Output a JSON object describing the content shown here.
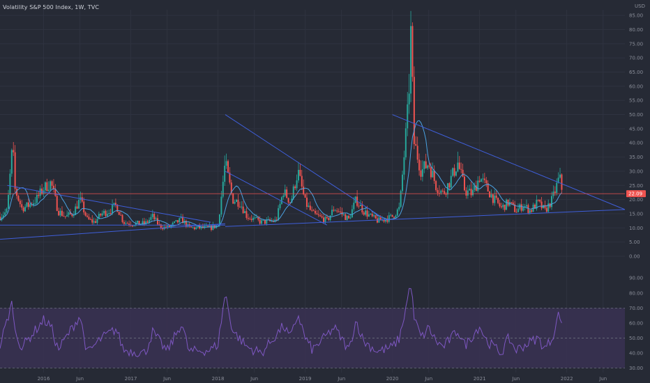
{
  "header": {
    "title": "Volatility S&P 500 Index, 1W, TVC"
  },
  "colors": {
    "background": "#262a35",
    "grid": "#2f3340",
    "up": "#26a69a",
    "down": "#ef5350",
    "trendline": "#3f5fdb",
    "ma": "#4ba3e3",
    "price_line": "#ef5350",
    "rsi_line": "#7e57c2",
    "rsi_band": "#3a3152"
  },
  "chart_data": [
    {
      "type": "candlestick",
      "name": "price-panel",
      "currency": "USD",
      "ylim": [
        0,
        87
      ],
      "yticks": [
        "0.00",
        "5.00",
        "10.00",
        "15.00",
        "20.00",
        "25.00",
        "30.00",
        "35.00",
        "40.00",
        "45.00",
        "50.00",
        "55.00",
        "60.00",
        "65.00",
        "70.00",
        "75.00",
        "80.00",
        "85.00"
      ],
      "current_value": 22.09,
      "x_range": [
        "2015-07",
        "2022-09"
      ],
      "xticks": [
        {
          "label": "2016",
          "date": "2016-01"
        },
        {
          "label": "Jun",
          "date": "2016-06"
        },
        {
          "label": "2017",
          "date": "2017-01"
        },
        {
          "label": "Jun",
          "date": "2017-06"
        },
        {
          "label": "2018",
          "date": "2018-01"
        },
        {
          "label": "Jun",
          "date": "2018-06"
        },
        {
          "label": "2019",
          "date": "2019-01"
        },
        {
          "label": "Jun",
          "date": "2019-06"
        },
        {
          "label": "2020",
          "date": "2020-01"
        },
        {
          "label": "Jun",
          "date": "2020-06"
        },
        {
          "label": "2021",
          "date": "2021-01"
        },
        {
          "label": "Jun",
          "date": "2021-06"
        },
        {
          "label": "2022",
          "date": "2022-01"
        },
        {
          "label": "Jun",
          "date": "2022-06"
        }
      ],
      "keypoints": [
        [
          "2015-07",
          14
        ],
        [
          "2015-08",
          16
        ],
        [
          "2015-08-24",
          40
        ],
        [
          "2015-09",
          24
        ],
        [
          "2015-10",
          17
        ],
        [
          "2015-11",
          18
        ],
        [
          "2015-12",
          20
        ],
        [
          "2016-01",
          24
        ],
        [
          "2016-02",
          26
        ],
        [
          "2016-03",
          16
        ],
        [
          "2016-04",
          14
        ],
        [
          "2016-05",
          15
        ],
        [
          "2016-06",
          20
        ],
        [
          "2016-07",
          13
        ],
        [
          "2016-08",
          12
        ],
        [
          "2016-09",
          15
        ],
        [
          "2016-10",
          16
        ],
        [
          "2016-11",
          18
        ],
        [
          "2016-12",
          12
        ],
        [
          "2017-01",
          11.5
        ],
        [
          "2017-03",
          11.5
        ],
        [
          "2017-04",
          14
        ],
        [
          "2017-05",
          10.5
        ],
        [
          "2017-06",
          10
        ],
        [
          "2017-08",
          13
        ],
        [
          "2017-09",
          10
        ],
        [
          "2017-11",
          10
        ],
        [
          "2017-12",
          10
        ],
        [
          "2018-01",
          11
        ],
        [
          "2018-02",
          33
        ],
        [
          "2018-03",
          20
        ],
        [
          "2018-04",
          19
        ],
        [
          "2018-05",
          14
        ],
        [
          "2018-06",
          13
        ],
        [
          "2018-07",
          12
        ],
        [
          "2018-09",
          12.5
        ],
        [
          "2018-10",
          23
        ],
        [
          "2018-11",
          19
        ],
        [
          "2018-12",
          30
        ],
        [
          "2019-01",
          19
        ],
        [
          "2019-02",
          15
        ],
        [
          "2019-04",
          12.5
        ],
        [
          "2019-05",
          17
        ],
        [
          "2019-06",
          15
        ],
        [
          "2019-07",
          13
        ],
        [
          "2019-08",
          20
        ],
        [
          "2019-09",
          16
        ],
        [
          "2019-10",
          14
        ],
        [
          "2019-11",
          12.5
        ],
        [
          "2019-12",
          13
        ],
        [
          "2020-01",
          14
        ],
        [
          "2020-02",
          17
        ],
        [
          "2020-03-09",
          55
        ],
        [
          "2020-03-16",
          82
        ],
        [
          "2020-04",
          40
        ],
        [
          "2020-05",
          30
        ],
        [
          "2020-06",
          33
        ],
        [
          "2020-07",
          25
        ],
        [
          "2020-08",
          22
        ],
        [
          "2020-09",
          27
        ],
        [
          "2020-10",
          33
        ],
        [
          "2020-11",
          23
        ],
        [
          "2020-12",
          22
        ],
        [
          "2021-01",
          28
        ],
        [
          "2021-02",
          24
        ],
        [
          "2021-03",
          20
        ],
        [
          "2021-04",
          17
        ],
        [
          "2021-05",
          19
        ],
        [
          "2021-06",
          16
        ],
        [
          "2021-07",
          18
        ],
        [
          "2021-08",
          16
        ],
        [
          "2021-09",
          19
        ],
        [
          "2021-10",
          16
        ],
        [
          "2021-11",
          20
        ],
        [
          "2021-12-01",
          28
        ],
        [
          "2021-12-15",
          22
        ]
      ],
      "trendlines": [
        {
          "from": [
            "2015-08",
            25
          ],
          "to": [
            "2017-12",
            12
          ]
        },
        {
          "from": [
            "2015-07",
            11
          ],
          "to": [
            "2018-02",
            11
          ]
        },
        {
          "from": [
            "2015-07",
            6
          ],
          "to": [
            "2018-02",
            11.5
          ]
        },
        {
          "from": [
            "2018-02",
            50
          ],
          "to": [
            "2019-12",
            13
          ]
        },
        {
          "from": [
            "2018-02",
            30
          ],
          "to": [
            "2019-04",
            11
          ]
        },
        {
          "from": [
            "2018-02",
            10.5
          ],
          "to": [
            "2022-09",
            16.5
          ]
        },
        {
          "from": [
            "2020-01",
            50
          ],
          "to": [
            "2022-09",
            16.5
          ]
        }
      ]
    },
    {
      "type": "line",
      "name": "rsi-panel",
      "ylim": [
        27,
        98
      ],
      "yticks": [
        "30.00",
        "40.00",
        "50.00",
        "60.00",
        "70.00",
        "80.00",
        "90.00"
      ],
      "band": [
        30,
        70
      ],
      "midline": 50,
      "keypoints": [
        [
          "2015-07",
          45
        ],
        [
          "2015-08-24",
          75
        ],
        [
          "2015-09",
          55
        ],
        [
          "2015-10",
          44
        ],
        [
          "2016-01",
          62
        ],
        [
          "2016-02",
          58
        ],
        [
          "2016-03",
          42
        ],
        [
          "2016-06",
          65
        ],
        [
          "2016-07",
          40
        ],
        [
          "2016-09",
          50
        ],
        [
          "2016-11",
          56
        ],
        [
          "2016-12",
          42
        ],
        [
          "2017-03",
          40
        ],
        [
          "2017-04",
          54
        ],
        [
          "2017-06",
          41
        ],
        [
          "2017-08",
          60
        ],
        [
          "2017-09",
          41
        ],
        [
          "2017-12",
          42
        ],
        [
          "2018-01",
          46
        ],
        [
          "2018-02",
          80
        ],
        [
          "2018-03",
          55
        ],
        [
          "2018-05",
          44
        ],
        [
          "2018-07",
          40
        ],
        [
          "2018-10",
          58
        ],
        [
          "2018-11",
          50
        ],
        [
          "2018-12",
          66
        ],
        [
          "2019-01",
          50
        ],
        [
          "2019-02",
          42
        ],
        [
          "2019-05",
          57
        ],
        [
          "2019-07",
          42
        ],
        [
          "2019-08",
          62
        ],
        [
          "2019-09",
          48
        ],
        [
          "2019-11",
          41
        ],
        [
          "2020-01",
          44
        ],
        [
          "2020-02",
          50
        ],
        [
          "2020-03-09",
          80
        ],
        [
          "2020-03-16",
          88
        ],
        [
          "2020-04",
          63
        ],
        [
          "2020-05",
          50
        ],
        [
          "2020-06",
          57
        ],
        [
          "2020-07",
          48
        ],
        [
          "2020-08",
          44
        ],
        [
          "2020-10",
          55
        ],
        [
          "2020-11",
          45
        ],
        [
          "2021-01",
          58
        ],
        [
          "2021-02",
          48
        ],
        [
          "2021-04",
          40
        ],
        [
          "2021-05",
          50
        ],
        [
          "2021-06",
          42
        ],
        [
          "2021-09",
          50
        ],
        [
          "2021-10",
          43
        ],
        [
          "2021-11",
          50
        ],
        [
          "2021-12-01",
          68
        ],
        [
          "2021-12-15",
          52
        ]
      ]
    }
  ]
}
